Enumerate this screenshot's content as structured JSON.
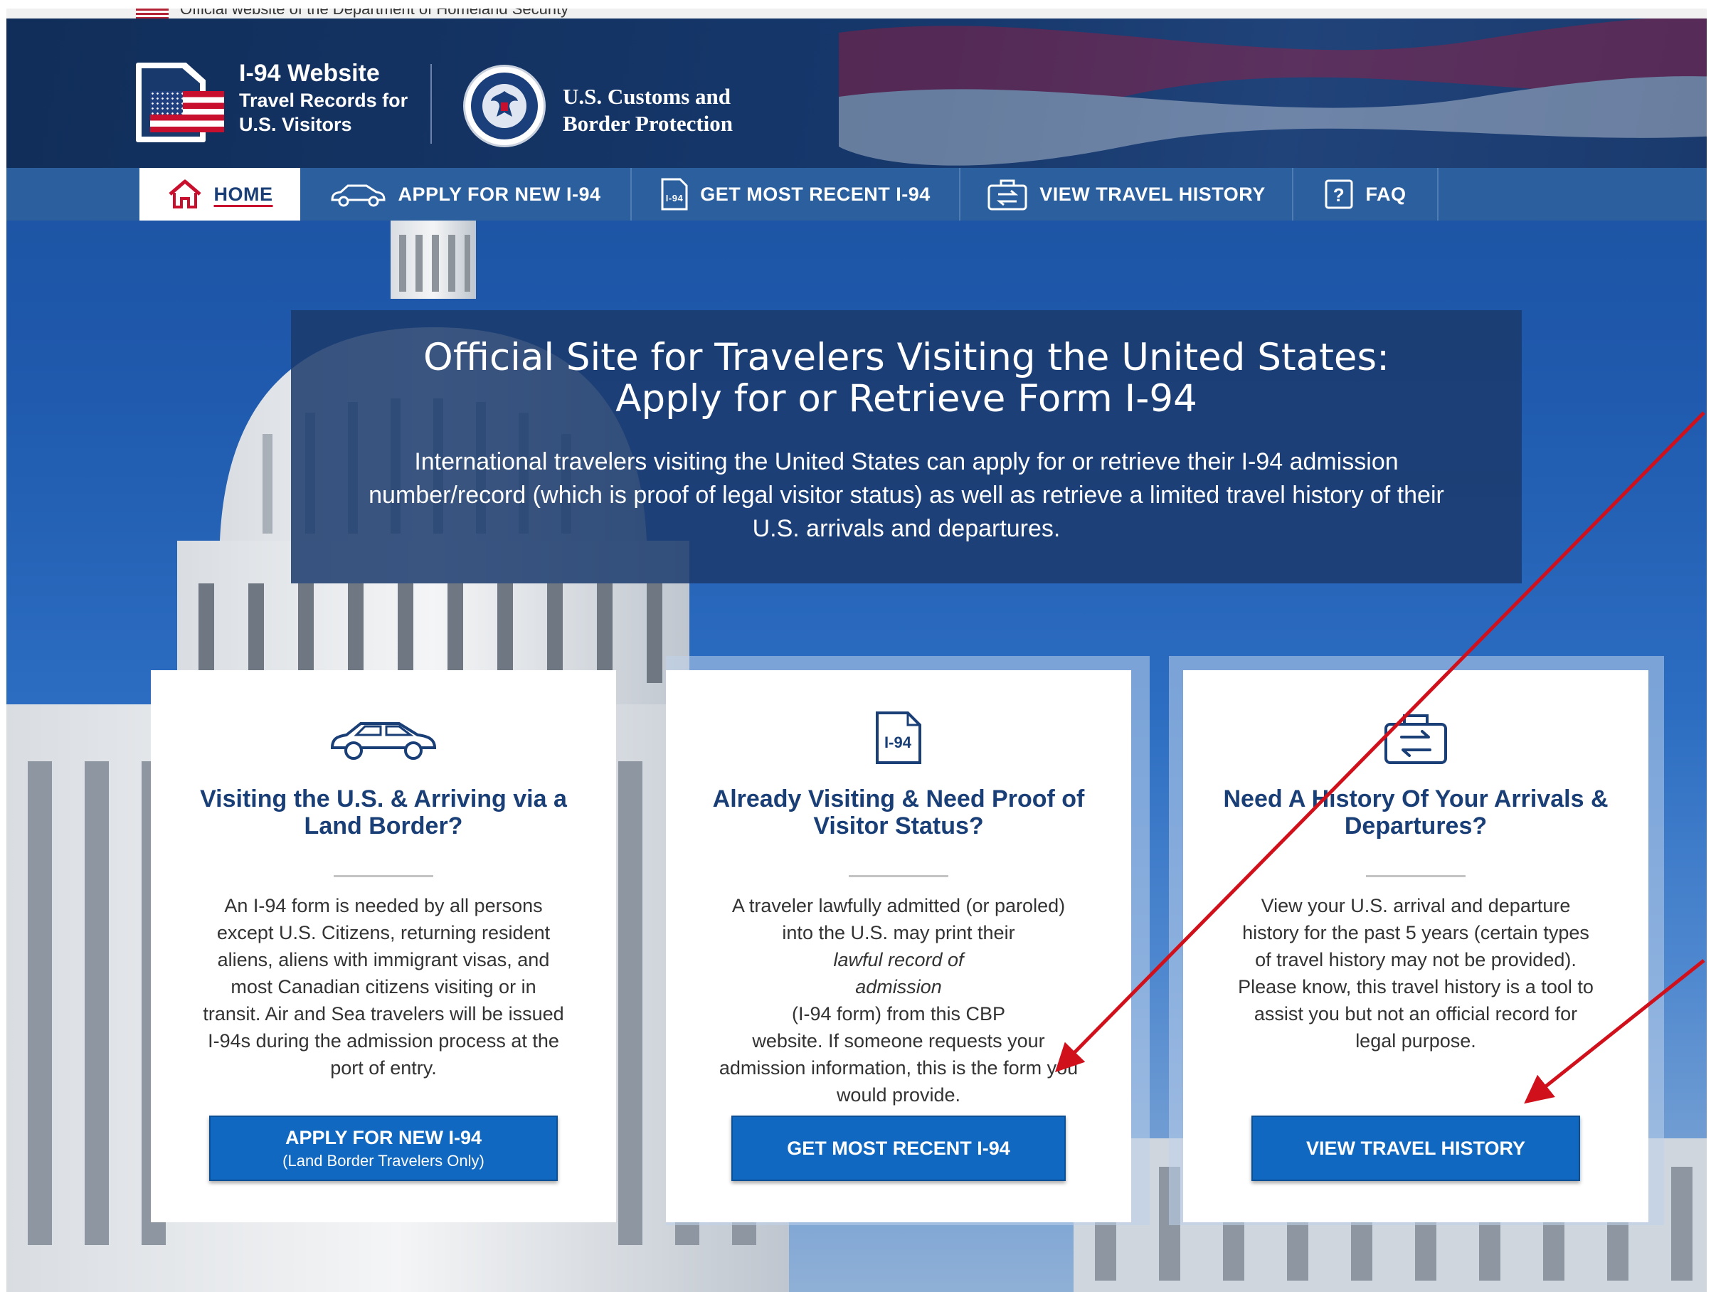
{
  "gov_banner": {
    "text": "Official website of the Department of Homeland Security"
  },
  "brand": {
    "title": "I-94 Website",
    "subtitle_line1": "Travel Records for",
    "subtitle_line2": "U.S. Visitors",
    "agency_line1": "U.S. Customs and",
    "agency_line2": "Border Protection"
  },
  "nav": {
    "items": [
      {
        "label": "HOME",
        "icon": "house-icon",
        "active": true
      },
      {
        "label": "APPLY FOR NEW I-94",
        "icon": "car-icon"
      },
      {
        "label": "GET MOST RECENT I-94",
        "icon": "i94-document-icon"
      },
      {
        "label": "VIEW TRAVEL HISTORY",
        "icon": "travel-history-icon"
      },
      {
        "label": "FAQ",
        "icon": "question-icon"
      }
    ]
  },
  "intro": {
    "title_line1": "Official Site for Travelers Visiting the United States:",
    "title_line2": "Apply for or Retrieve Form I-94",
    "body_line1": "International travelers visiting the United States can apply for or retrieve their I-94 admission",
    "body_line2": "number/record (which is proof of legal visitor status) as well as retrieve a limited travel history of their",
    "body_line3": "U.S. arrivals and departures."
  },
  "cards": [
    {
      "icon": "car-icon",
      "title_line1": "Visiting the U.S. & Arriving via a",
      "title_line2": "Land Border?",
      "text_lines": [
        "An I-94 form is needed by all persons",
        "except U.S. Citizens, returning resident",
        "aliens, aliens with immigrant visas, and",
        "most Canadian citizens visiting or in",
        "transit. Air and Sea travelers will be issued",
        "I-94s during the admission process at the",
        "port of entry."
      ],
      "button_label": "APPLY FOR NEW I-94",
      "button_sublabel": "(Land Border Travelers Only)"
    },
    {
      "icon": "i94-document-icon",
      "title_line1": "Already Visiting & Need Proof of",
      "title_line2": "Visitor Status?",
      "text_line1": "A traveler lawfully admitted (or paroled)",
      "text_line2_pre": "into the U.S. may print their ",
      "text_line2_em": "lawful record of",
      "text_line3_em": "admission",
      "text_line3_post": " (I-94 form) from this CBP",
      "text_line4": "website. If someone requests your",
      "text_line5": "admission information, this is the form you",
      "text_line6": "would provide.",
      "button_label": "GET MOST RECENT I-94"
    },
    {
      "icon": "travel-history-icon",
      "title_line1": "Need A History Of Your Arrivals &",
      "title_line2": "Departures?",
      "text_lines": [
        "View your U.S. arrival and departure",
        "history for the past 5 years (certain types",
        "of travel history may not be provided).",
        "Please know, this travel history is a tool to",
        "assist you but not an official record for",
        "legal purpose."
      ],
      "button_label": "VIEW TRAVEL HISTORY"
    }
  ],
  "icon_labels": {
    "i94": "I-94"
  },
  "colors": {
    "navy": "#1a3f77",
    "nav_bar": "#2b5f9e",
    "button_blue": "#1168c0",
    "annotation_red": "#d0101b"
  }
}
